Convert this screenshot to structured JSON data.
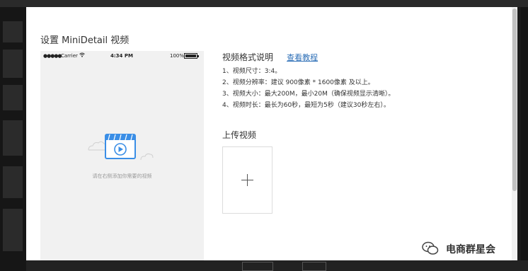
{
  "modal": {
    "title": "设置 MiniDetail 视频"
  },
  "phone": {
    "carrier": "Carrier",
    "time": "4:34 PM",
    "battery": "100%",
    "empty_text": "请在右侧添加你需要的视频",
    "signal_dots": "●●●●●"
  },
  "spec": {
    "title": "视频格式说明",
    "link": "查看教程",
    "items": [
      "1、视频尺寸：3:4。",
      "2、视频分辨率：建议 900像素 * 1600像素 及以上。",
      "3、视频大小：最大200M，最小20M（确保视频显示清晰）。",
      "4、视频时长：最长为60秒，最短为5秒（建议30秒左右）。"
    ]
  },
  "upload": {
    "title": "上传视频"
  },
  "watermark": {
    "text": "电商群星会"
  },
  "colors": {
    "link": "#2d6fb7",
    "icon_blue": "#3a8ee6",
    "overlay": "#1b1b1b"
  },
  "icons": [
    "wifi-icon",
    "battery-icon",
    "video-play-icon",
    "cloud-icon",
    "plus-icon",
    "wechat-logo-icon"
  ]
}
